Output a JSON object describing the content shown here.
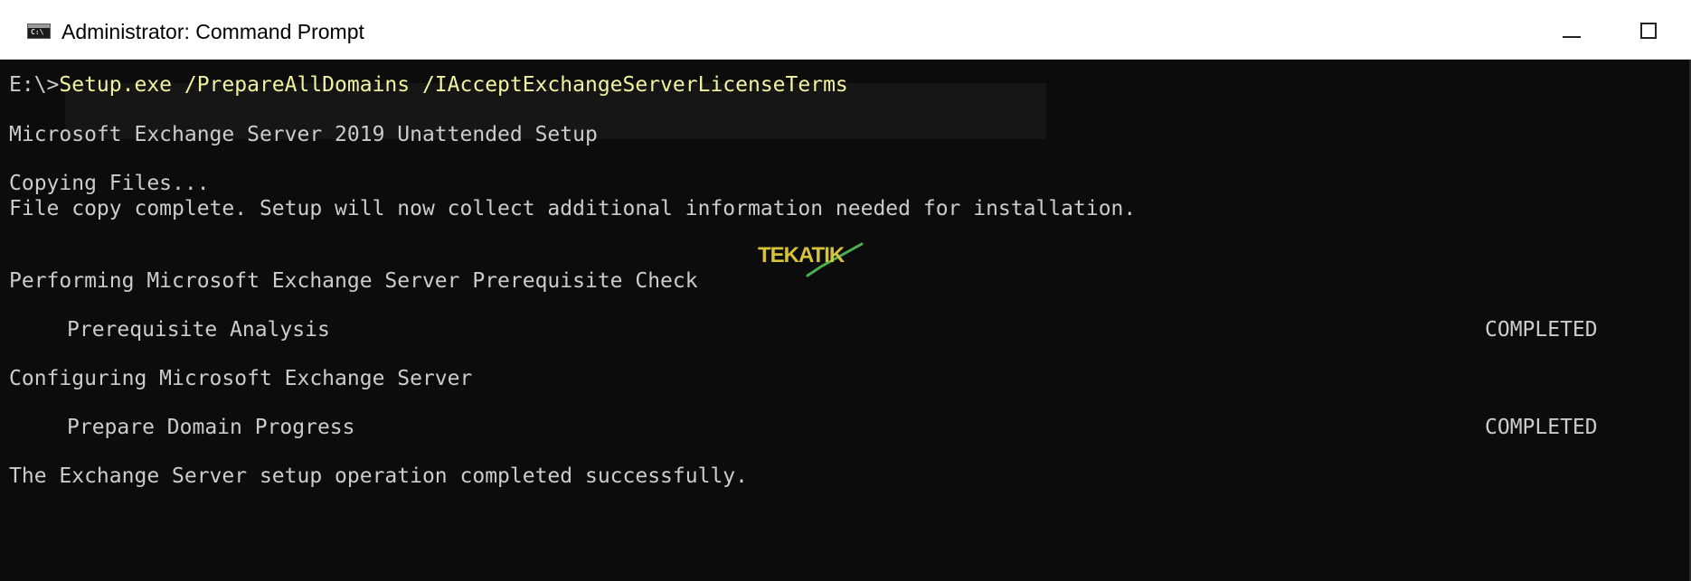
{
  "window": {
    "title": "Administrator: Command Prompt",
    "icon": "cmd-icon",
    "icon_text": "C:\\"
  },
  "controls": {
    "minimize_icon": "minimize-icon",
    "maximize_icon": "maximize-icon"
  },
  "console": {
    "prompt": "E:\\>",
    "command": "Setup.exe /PrepareAllDomains /IAcceptExchangeServerLicenseTerms",
    "lines": [
      "Microsoft Exchange Server 2019 Unattended Setup",
      "Copying Files...",
      "File copy complete. Setup will now collect additional information needed for installation.",
      "Performing Microsoft Exchange Server Prerequisite Check",
      "Prerequisite Analysis",
      "Configuring Microsoft Exchange Server",
      "Prepare Domain Progress",
      "The Exchange Server setup operation completed successfully."
    ],
    "statuses": [
      "COMPLETED",
      "COMPLETED"
    ]
  },
  "watermark": {
    "text": "TEKATIK"
  },
  "colors": {
    "console_bg": "#0c0c0c",
    "console_text": "#cccccc",
    "command_text": "#f2f2a0",
    "titlebar_bg": "#ffffff"
  }
}
